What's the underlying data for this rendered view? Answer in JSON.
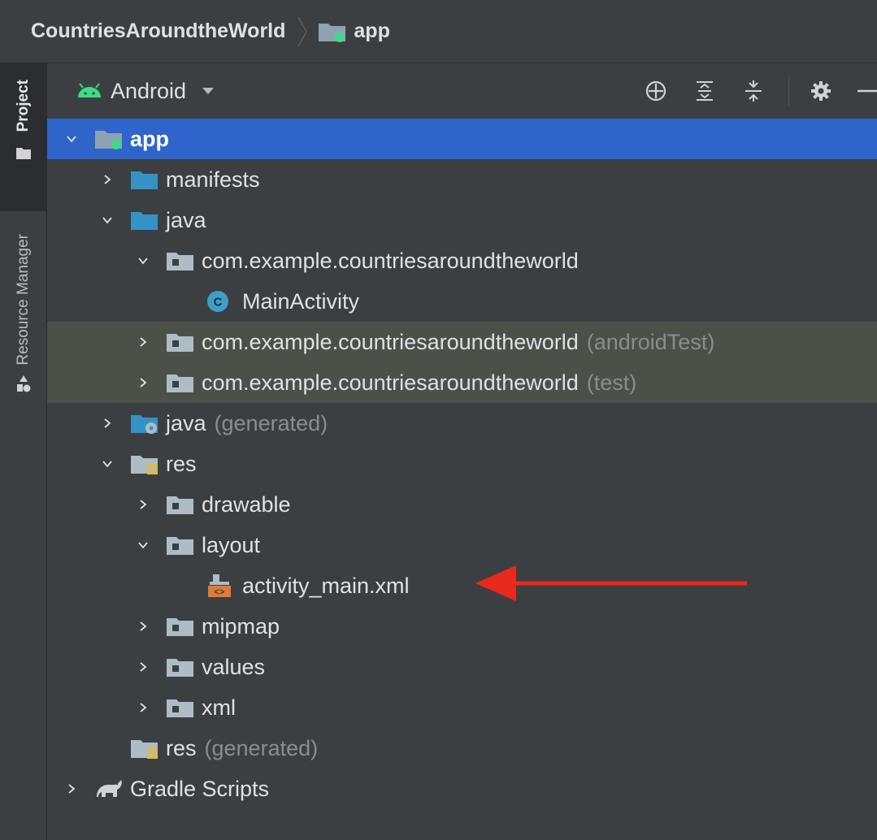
{
  "breadcrumb": {
    "project": "CountriesAroundtheWorld",
    "module": "app"
  },
  "side_tabs": {
    "project": "Project",
    "resource_manager": "Resource Manager"
  },
  "toolbar": {
    "view_mode": "Android",
    "icons": [
      "locate-icon",
      "expand-all-icon",
      "collapse-all-icon",
      "gear-icon",
      "minimize-icon"
    ]
  },
  "tree": [
    {
      "label": "app",
      "suffix": "",
      "expanded": true,
      "selected": true,
      "icon": "module-folder-icon"
    },
    {
      "label": "manifests",
      "suffix": "",
      "expanded": false,
      "icon": "folder-icon"
    },
    {
      "label": "java",
      "suffix": "",
      "expanded": true,
      "icon": "source-folder-icon"
    },
    {
      "label": "com.example.countriesaroundtheworld",
      "suffix": "",
      "expanded": true,
      "icon": "package-icon"
    },
    {
      "label": "MainActivity",
      "suffix": "",
      "icon": "class-icon"
    },
    {
      "label": "com.example.countriesaroundtheworld",
      "suffix": "(androidTest)",
      "expanded": false,
      "icon": "package-icon"
    },
    {
      "label": "com.example.countriesaroundtheworld",
      "suffix": "(test)",
      "expanded": false,
      "icon": "package-icon"
    },
    {
      "label": "java",
      "suffix": "(generated)",
      "expanded": false,
      "icon": "generated-folder-icon"
    },
    {
      "label": "res",
      "suffix": "",
      "expanded": true,
      "icon": "resource-folder-icon"
    },
    {
      "label": "drawable",
      "suffix": "",
      "expanded": false,
      "icon": "package-icon"
    },
    {
      "label": "layout",
      "suffix": "",
      "expanded": true,
      "icon": "package-icon"
    },
    {
      "label": "activity_main.xml",
      "suffix": "",
      "icon": "layout-xml-icon"
    },
    {
      "label": "mipmap",
      "suffix": "",
      "expanded": false,
      "icon": "package-icon"
    },
    {
      "label": "values",
      "suffix": "",
      "expanded": false,
      "icon": "package-icon"
    },
    {
      "label": "xml",
      "suffix": "",
      "expanded": false,
      "icon": "package-icon"
    },
    {
      "label": "res",
      "suffix": "(generated)",
      "icon": "resource-folder-icon"
    },
    {
      "label": "Gradle Scripts",
      "suffix": "",
      "expanded": false,
      "icon": "gradle-icon"
    }
  ],
  "colors": {
    "selection": "#2f65ca",
    "test_source_bg": "#4b5148",
    "annotation_arrow": "#e8291c",
    "android_green": "#3ddc84"
  }
}
